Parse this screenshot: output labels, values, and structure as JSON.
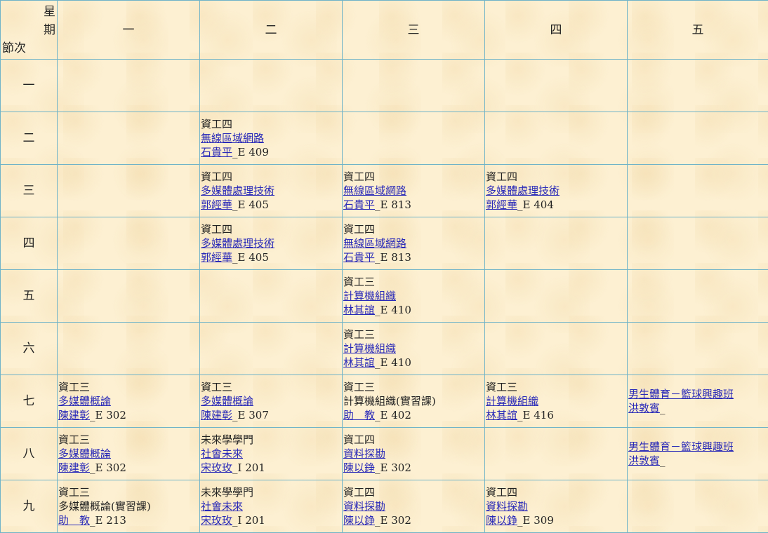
{
  "header": {
    "corner_top": "星",
    "corner_mid": "期",
    "corner_bottom": "節次",
    "days": [
      "一",
      "二",
      "三",
      "四",
      "五"
    ]
  },
  "periods": [
    "一",
    "二",
    "三",
    "四",
    "五",
    "六",
    "七",
    "八",
    "九"
  ],
  "rows": [
    {
      "cells": [
        null,
        null,
        null,
        null,
        null
      ]
    },
    {
      "cells": [
        null,
        {
          "class": "資工四",
          "course": "無線區域網路",
          "course_link": true,
          "teacher": "石貴平",
          "room": "_E 409"
        },
        null,
        null,
        null
      ]
    },
    {
      "cells": [
        null,
        {
          "class": "資工四",
          "course": "多媒體處理技術",
          "course_link": true,
          "teacher": "郭經華",
          "room": "_E 405"
        },
        {
          "class": "資工四",
          "course": "無線區域網路",
          "course_link": true,
          "teacher": "石貴平",
          "room": "_E 813"
        },
        {
          "class": "資工四",
          "course": "多媒體處理技術",
          "course_link": true,
          "teacher": "郭經華",
          "room": "_E 404"
        },
        null
      ]
    },
    {
      "cells": [
        null,
        {
          "class": "資工四",
          "course": "多媒體處理技術",
          "course_link": true,
          "teacher": "郭經華",
          "room": "_E 405"
        },
        {
          "class": "資工四",
          "course": "無線區域網路",
          "course_link": true,
          "teacher": "石貴平",
          "room": "_E 813"
        },
        null,
        null
      ]
    },
    {
      "cells": [
        null,
        null,
        {
          "class": "資工三",
          "course": "計算機組織",
          "course_link": true,
          "teacher": "林其誼",
          "room": "_E 410"
        },
        null,
        null
      ]
    },
    {
      "cells": [
        null,
        null,
        {
          "class": "資工三",
          "course": "計算機組織",
          "course_link": true,
          "teacher": "林其誼",
          "room": "_E 410"
        },
        null,
        null
      ]
    },
    {
      "cells": [
        {
          "class": "資工三",
          "course": "多媒體概論",
          "course_link": true,
          "teacher": "陳建彰",
          "room": "_E 302"
        },
        {
          "class": "資工三",
          "course": "多媒體概論",
          "course_link": true,
          "teacher": "陳建彰",
          "room": "_E 307"
        },
        {
          "class": "資工三",
          "course": "計算機組織(實習課)",
          "course_link": false,
          "teacher": "助　教",
          "room": "_E 402"
        },
        {
          "class": "資工三",
          "course": "計算機組織",
          "course_link": true,
          "teacher": "林其誼",
          "room": "_E 416"
        },
        {
          "class": "",
          "course": "男生體育－籃球興趣班",
          "course_link": true,
          "teacher": "洪敦賓",
          "room": "_"
        }
      ]
    },
    {
      "cells": [
        {
          "class": "資工三",
          "course": "多媒體概論",
          "course_link": true,
          "teacher": "陳建彰",
          "room": "_E 302"
        },
        {
          "class": "未來學學門",
          "course": "社會未來",
          "course_link": true,
          "teacher": "宋玫玫",
          "room": "_I 201"
        },
        {
          "class": "資工四",
          "course": "資料探勘",
          "course_link": true,
          "teacher": "陳以錚",
          "room": "_E 302"
        },
        null,
        {
          "class": "",
          "course": "男生體育－籃球興趣班",
          "course_link": true,
          "teacher": "洪敦賓",
          "room": "_"
        }
      ]
    },
    {
      "cells": [
        {
          "class": "資工三",
          "course": "多媒體概論(實習課)",
          "course_link": false,
          "teacher": "助　教",
          "room": "_E 213"
        },
        {
          "class": "未來學學門",
          "course": "社會未來",
          "course_link": true,
          "teacher": "宋玫玫",
          "room": "_I 201"
        },
        {
          "class": "資工四",
          "course": "資料探勘",
          "course_link": true,
          "teacher": "陳以錚",
          "room": "_E 302"
        },
        {
          "class": "資工四",
          "course": "資料探勘",
          "course_link": true,
          "teacher": "陳以錚",
          "room": "_E 309"
        },
        null
      ]
    }
  ],
  "colors": {
    "background": "#fdf0d2",
    "grid": "#6fb3c8",
    "link": "#2a2ab8",
    "text": "#222222"
  }
}
